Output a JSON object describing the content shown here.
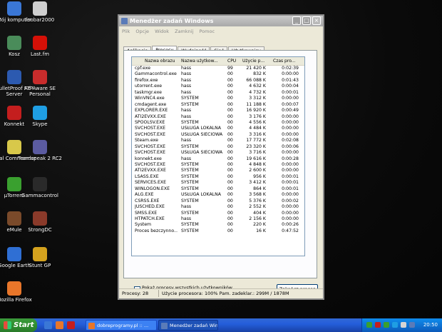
{
  "desktop": {
    "icons": [
      {
        "label": "Mój komputer",
        "color": "#3a77d6"
      },
      {
        "label": "foobar2000",
        "color": "#cfcfcf"
      },
      {
        "label": "Kosz",
        "color": "#4a8c5a"
      },
      {
        "label": "Last.fm",
        "color": "#d51007"
      },
      {
        "label": "BulletProof FTP Server",
        "color": "#2c5ab0"
      },
      {
        "label": "Ad-Aware SE Personal",
        "color": "#c82c2c"
      },
      {
        "label": "Konnekt",
        "color": "#c41e1e"
      },
      {
        "label": "Skype",
        "color": "#1f9ee3"
      },
      {
        "label": "Total Commander",
        "color": "#d8c84a"
      },
      {
        "label": "Teamspeak 2 RC2",
        "color": "#5b5ba0"
      },
      {
        "label": "µTorrent",
        "color": "#3aa02f"
      },
      {
        "label": "Gammacontrol",
        "color": "#2a2a2a"
      },
      {
        "label": "eMule",
        "color": "#7a4a2a"
      },
      {
        "label": "StrongDC",
        "color": "#8a3a2a"
      },
      {
        "label": "Google Earth",
        "color": "#2f6fd4"
      },
      {
        "label": "Stunt GP",
        "color": "#d4a21e"
      },
      {
        "label": "Mozilla Firefox",
        "color": "#e8762a"
      }
    ]
  },
  "window": {
    "title": "Menedżer zadań Windows",
    "menu": [
      "Plik",
      "Opcje",
      "Widok",
      "Zamknij",
      "Pomoc"
    ],
    "tabs": [
      "Aplikacje",
      "Procesy",
      "Wydajność",
      "Sieć",
      "Użytkownicy"
    ],
    "active_tab": "Procesy",
    "columns": [
      "Nazwa obrazu",
      "Nazwa użytkow...",
      "CPU",
      "Użycie p...",
      "Czas pro..."
    ],
    "processes": [
      [
        "cpf.exe",
        "hass",
        "99",
        "21 420 K",
        "0:02:39"
      ],
      [
        "Gammacontrol.exe",
        "hass",
        "00",
        "832 K",
        "0:00:00"
      ],
      [
        "firefox.exe",
        "hass",
        "00",
        "66 088 K",
        "0:01:43"
      ],
      [
        "utorrent.exe",
        "hass",
        "00",
        "4 632 K",
        "0:00:04"
      ],
      [
        "taskmgr.exe",
        "hass",
        "00",
        "4 732 K",
        "0:00:01"
      ],
      [
        "WinVNC4.exe",
        "SYSTEM",
        "00",
        "3 312 K",
        "0:00:00"
      ],
      [
        "cmdagent.exe",
        "SYSTEM",
        "00",
        "11 188 K",
        "0:00:07"
      ],
      [
        "EXPLORER.EXE",
        "hass",
        "00",
        "16 920 K",
        "0:00:49"
      ],
      [
        "ATI2EVXX.EXE",
        "hass",
        "00",
        "3 176 K",
        "0:00:00"
      ],
      [
        "SPOOLSV.EXE",
        "SYSTEM",
        "00",
        "4 556 K",
        "0:00:00"
      ],
      [
        "SVCHOST.EXE",
        "USŁUGA LOKALNA",
        "00",
        "4 484 K",
        "0:00:00"
      ],
      [
        "SVCHOST.EXE",
        "USŁUGA SIECIOWA",
        "00",
        "3 316 K",
        "0:00:00"
      ],
      [
        "Steam.exe",
        "hass",
        "00",
        "17 772 K",
        "0:02:08"
      ],
      [
        "SVCHOST.EXE",
        "SYSTEM",
        "00",
        "23 320 K",
        "0:00:06"
      ],
      [
        "SVCHOST.EXE",
        "USŁUGA SIECIOWA",
        "00",
        "3 716 K",
        "0:00:00"
      ],
      [
        "konnekt.exe",
        "hass",
        "00",
        "19 616 K",
        "0:00:28"
      ],
      [
        "SVCHOST.EXE",
        "SYSTEM",
        "00",
        "4 848 K",
        "0:00:00"
      ],
      [
        "ATI2EVXX.EXE",
        "SYSTEM",
        "00",
        "2 600 K",
        "0:00:00"
      ],
      [
        "LSASS.EXE",
        "SYSTEM",
        "00",
        "956 K",
        "0:00:01"
      ],
      [
        "SERVICES.EXE",
        "SYSTEM",
        "00",
        "3 412 K",
        "0:00:01"
      ],
      [
        "WINLOGON.EXE",
        "SYSTEM",
        "00",
        "864 K",
        "0:00:01"
      ],
      [
        "ALG.EXE",
        "USŁUGA LOKALNA",
        "00",
        "3 568 K",
        "0:00:00"
      ],
      [
        "CSRSS.EXE",
        "SYSTEM",
        "00",
        "5 376 K",
        "0:00:02"
      ],
      [
        "JUSCHED.EXE",
        "hass",
        "00",
        "2 552 K",
        "0:00:00"
      ],
      [
        "SMSS.EXE",
        "SYSTEM",
        "00",
        "404 K",
        "0:00:00"
      ],
      [
        "HTPATCH.EXE",
        "hass",
        "00",
        "2 156 K",
        "0:00:00"
      ],
      [
        "System",
        "SYSTEM",
        "00",
        "220 K",
        "0:00:26"
      ],
      [
        "Proces bezczynno...",
        "SYSTEM",
        "00",
        "16 K",
        "0:47:52"
      ]
    ],
    "show_all_label": "Pokaż procesy wszystkich użytkowników",
    "end_process_label": "Zakończ proces",
    "status_processes": "Procesy: 28",
    "status_usage": "Użycie procesora: 100%  Pam. zadeklar.: 299M / 1878M"
  },
  "taskbar": {
    "start_label": "Start",
    "tasks": [
      {
        "label": "dobreprogramy.pl :: ...",
        "color": "#e8762a"
      },
      {
        "label": "Menedżer zadań Win...",
        "color": "#5a7bb8"
      }
    ],
    "clock": "20:50"
  }
}
